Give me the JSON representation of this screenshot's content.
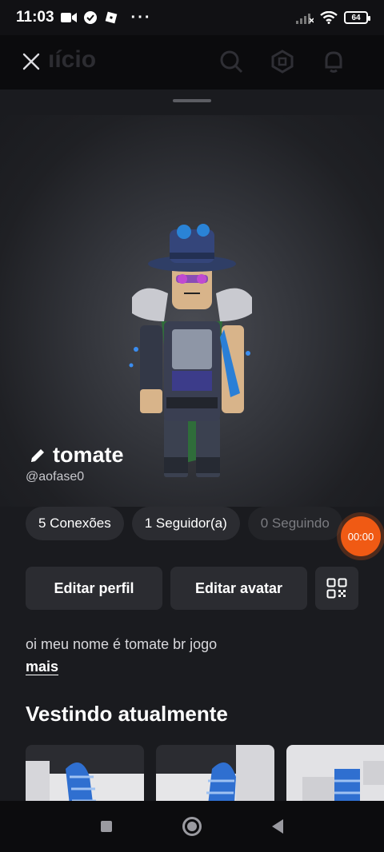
{
  "status_bar": {
    "time": "11:03",
    "battery": "64",
    "icons": [
      "video-camera-icon",
      "check-badge-icon",
      "roblox-icon",
      "more-dots-icon",
      "signal-icon",
      "wifi-icon",
      "battery-icon"
    ]
  },
  "top_bar": {
    "title_partial": "ıício",
    "close_icon": "close-icon",
    "icons": [
      "search-icon",
      "robux-icon",
      "bell-icon"
    ]
  },
  "profile": {
    "display_name": "tomate",
    "username": "@aofase0",
    "edit_icon": "pencil-icon"
  },
  "stats": {
    "connections": "5 Conexões",
    "followers": "1 Seguidor(a)",
    "following": "0 Seguindo"
  },
  "recorder": {
    "time": "00:00"
  },
  "actions": {
    "edit_profile": "Editar perfil",
    "edit_avatar": "Editar avatar",
    "qr_icon": "qr-code-icon"
  },
  "bio": {
    "text": "oi meu nome é tomate br jogo",
    "more": "mais"
  },
  "wearing": {
    "title": "Vestindo atualmente"
  },
  "colors": {
    "background": "#121215",
    "sheet": "#1a1b1f",
    "pill": "#2b2c31",
    "recorder": "#f05a14"
  }
}
